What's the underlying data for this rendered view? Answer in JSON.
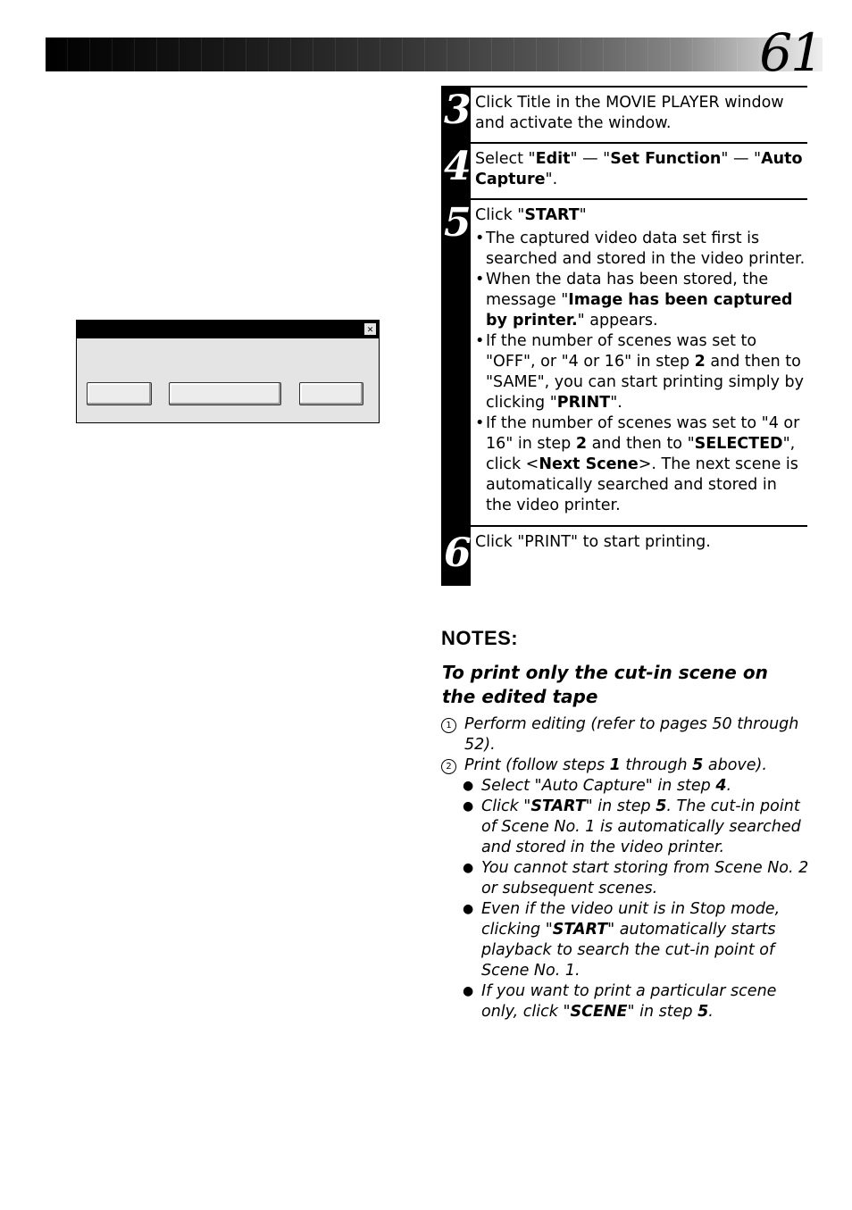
{
  "header": {
    "page_number": "61"
  },
  "dialog": {
    "close_icon": "close-icon",
    "buttons": [
      "",
      "",
      ""
    ]
  },
  "steps": [
    {
      "number": "3",
      "text": "Click Title in the MOVIE PLAYER window and activate the window."
    },
    {
      "number": "4",
      "text_parts": [
        "Select \"",
        "Edit",
        "\" — \"",
        "Set Function",
        "\" — \"",
        "Auto Capture",
        "\"."
      ]
    },
    {
      "number": "5",
      "intro_parts": [
        "Click \"",
        "START",
        "\""
      ],
      "bullets": [
        {
          "parts": [
            "The captured video data set first is searched and stored in the video printer."
          ]
        },
        {
          "parts": [
            "When the data has been stored, the message \"",
            "Image has been captured by printer.",
            "\" appears."
          ]
        },
        {
          "parts": [
            "If the number of scenes was set to \"OFF\", or \"4 or 16\" in step ",
            "2",
            " and then to \"SAME\", you can start printing simply by clicking \"",
            "PRINT",
            "\"."
          ]
        },
        {
          "parts": [
            "If the number of scenes was set to \"4 or 16\" in step ",
            "2",
            " and then to \"",
            "SELECTED",
            "\", click <",
            "Next Scene",
            ">.  The next scene is automatically searched and stored in the video printer."
          ]
        }
      ]
    },
    {
      "number": "6",
      "text": "Click \"PRINT\" to start printing."
    }
  ],
  "notes": {
    "title": "NOTES:",
    "subtitle": "To print only the cut-in scene on the edited tape",
    "items": [
      {
        "marker": "1",
        "text": "Perform editing (refer to pages 50 through 52)."
      },
      {
        "marker": "2",
        "parts": [
          "Print (follow steps ",
          "1",
          " through ",
          "5",
          " above)."
        ]
      }
    ],
    "bullets": [
      {
        "parts": [
          "Select \"Auto Capture\" in step ",
          "4",
          "."
        ]
      },
      {
        "parts": [
          "Click \"",
          "START",
          "\" in step ",
          "5",
          ". The cut-in point of Scene No. 1 is automatically searched and stored in the video printer."
        ]
      },
      {
        "parts": [
          "You cannot start storing from Scene No. 2 or subsequent scenes."
        ]
      },
      {
        "parts": [
          "Even if the video unit is in Stop mode, clicking \"",
          "START",
          "\" automatically starts playback  to search the cut-in point of Scene No. 1."
        ]
      },
      {
        "parts": [
          "If you want to print a particular scene only, click \"",
          "SCENE",
          "\" in step ",
          "5",
          "."
        ]
      }
    ]
  }
}
